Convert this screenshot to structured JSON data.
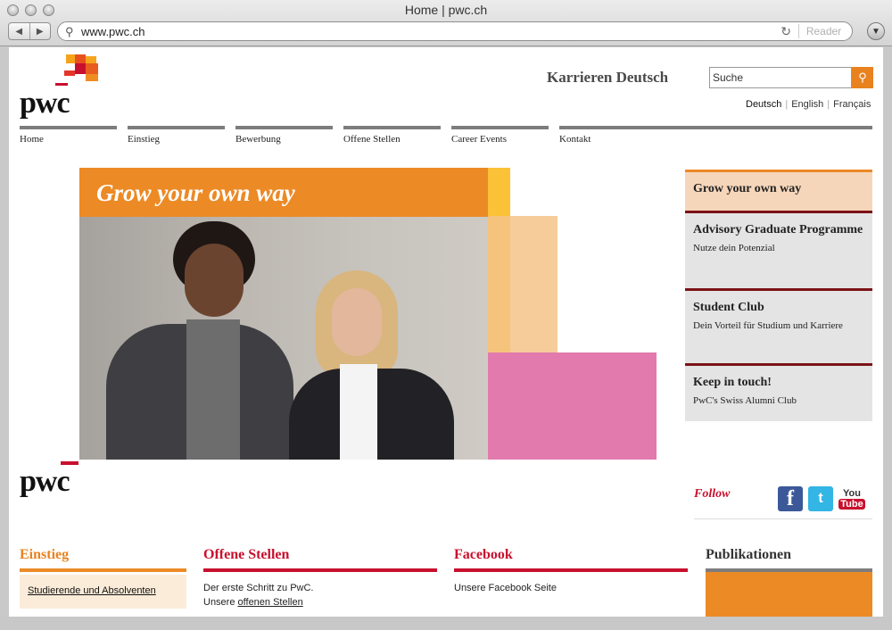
{
  "window": {
    "title": "Home | pwc.ch",
    "url": "www.pwc.ch",
    "reader_label": "Reader"
  },
  "header": {
    "logo_text": "pwc",
    "top_links": "Karrieren Deutsch",
    "search_placeholder": "Suche",
    "languages": [
      "Deutsch",
      "English",
      "Français"
    ]
  },
  "nav": {
    "items": [
      "Home",
      "Einstieg",
      "Bewerbung",
      "Offene Stellen",
      "Career Events",
      "Kontakt"
    ]
  },
  "hero": {
    "title": "Grow your own way"
  },
  "sidebar": {
    "cards": [
      {
        "title": "Grow your own way",
        "subtitle": ""
      },
      {
        "title": "Advisory Graduate Programme",
        "subtitle": "Nutze dein Potenzial"
      },
      {
        "title": "Student Club",
        "subtitle": "Dein Vorteil für Studium und Karriere"
      },
      {
        "title": "Keep in touch!",
        "subtitle": "PwC's Swiss Alumni Club"
      }
    ]
  },
  "follow": {
    "label": "Follow",
    "youtube_top": "You",
    "youtube_bottom": "Tube"
  },
  "columns": {
    "einstieg": {
      "title": "Einstieg",
      "link": "Studierende und Absolventen"
    },
    "stellen": {
      "title": "Offene Stellen",
      "line1": "Der erste Schritt zu PwC.",
      "line2_prefix": "Unsere ",
      "line2_link": "offenen Stellen"
    },
    "facebook": {
      "title": "Facebook",
      "line1": "Unsere Facebook Seite"
    },
    "publikationen": {
      "title": "Publikationen"
    }
  },
  "colors": {
    "orange": "#ec8a26",
    "red": "#c8102e",
    "dark_red": "#7b1318",
    "pink": "#e27aad",
    "yellow": "#fbc237"
  }
}
